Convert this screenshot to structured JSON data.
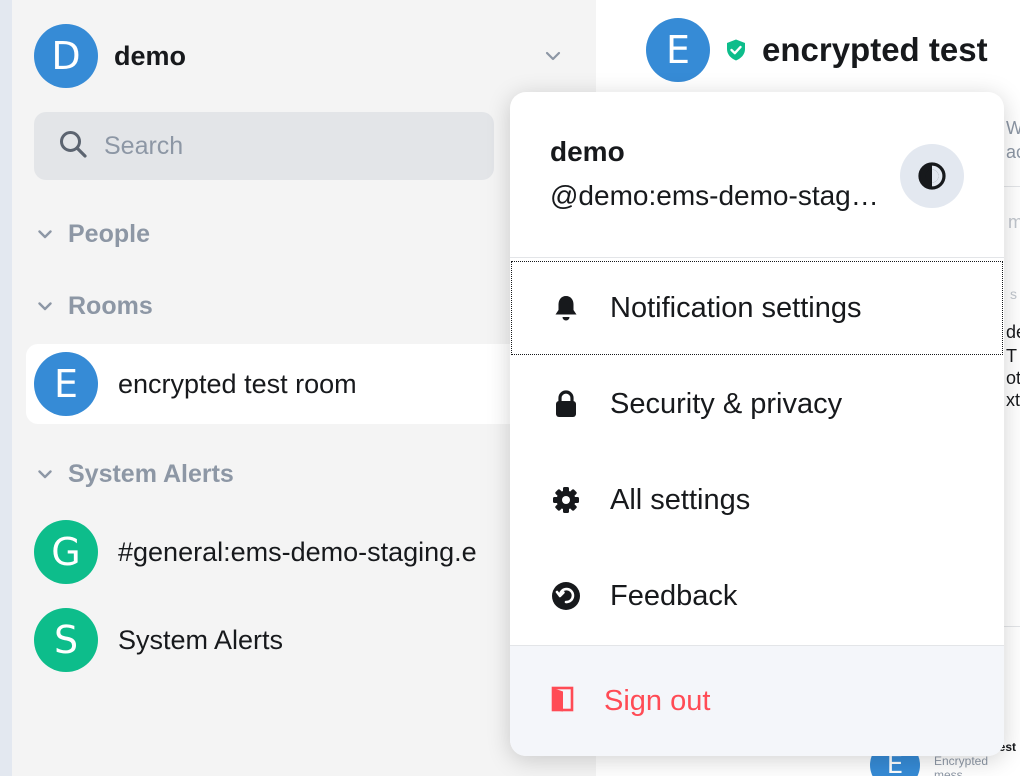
{
  "colors": {
    "accent_blue": "#368bd6",
    "accent_green": "#0dbd8b",
    "danger": "#ff4b55",
    "muted_text": "#8d97a5",
    "panel_bg": "#f4f4f4"
  },
  "account": {
    "avatar_letter": "D",
    "name": "demo",
    "icon": "chevron-down-icon"
  },
  "search": {
    "placeholder": "Search",
    "icon": "search-icon"
  },
  "sections": {
    "people": "People",
    "rooms": "Rooms",
    "system_alerts": "System Alerts"
  },
  "rooms": [
    {
      "avatar_letter": "E",
      "name": "encrypted test room",
      "selected": true
    }
  ],
  "system_alerts": [
    {
      "avatar_letter": "G",
      "name": "#general:ems-demo-staging.e"
    },
    {
      "avatar_letter": "S",
      "name": "System Alerts"
    }
  ],
  "room_header": {
    "avatar_letter": "E",
    "title": "encrypted test",
    "shield_icon": "shield-check-icon"
  },
  "background_fragments": {
    "w": "W",
    "ac": "ac",
    "m": "m",
    "s": "s",
    "de": "de",
    "t": "T",
    "ot": "ot",
    "xt": "xt",
    "peek_avatar": "E",
    "peek_title": "encrypted test",
    "peek_sub": "Encrypted mess"
  },
  "user_menu": {
    "display_name": "demo",
    "user_id": "@demo:ems-demo-staging.element.io",
    "theme_toggle_icon": "contrast-icon",
    "items": [
      {
        "label": "Notification settings",
        "icon": "bell-icon",
        "focused": true
      },
      {
        "label": "Security & privacy",
        "icon": "lock-icon"
      },
      {
        "label": "All settings",
        "icon": "gear-icon"
      },
      {
        "label": "Feedback",
        "icon": "feedback-icon"
      }
    ],
    "sign_out": {
      "label": "Sign out",
      "icon": "sign-out-icon"
    }
  }
}
